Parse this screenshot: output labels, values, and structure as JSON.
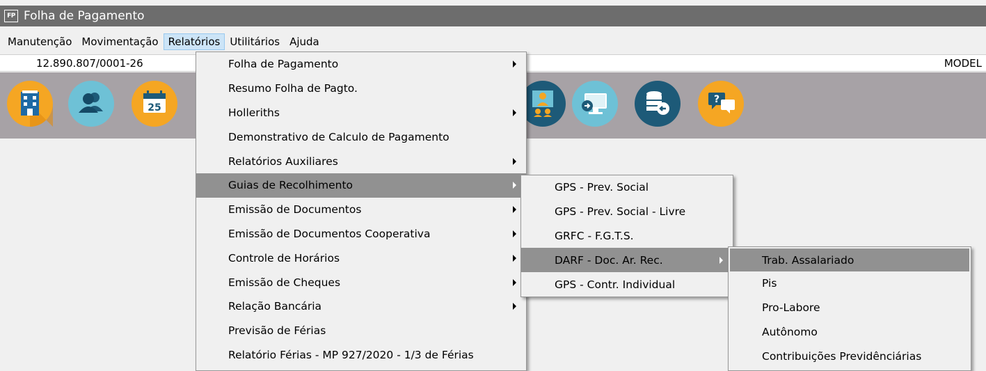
{
  "window": {
    "title": "Folha de Pagamento",
    "icon_text": "FP"
  },
  "menubar": {
    "items": [
      {
        "label": "Manutenção"
      },
      {
        "label": "Movimentação"
      },
      {
        "label": "Relatórios"
      },
      {
        "label": "Utilitários"
      },
      {
        "label": "Ajuda"
      }
    ],
    "active": "Relatórios"
  },
  "infobar": {
    "cnpj": "12.890.807/0001-26",
    "company": "MODEL"
  },
  "toolbar": {
    "buttons": [
      {
        "icon": "building-icon",
        "color": "#f5a623"
      },
      {
        "icon": "users-icon",
        "color": "#6ec1d6"
      },
      {
        "icon": "calendar-icon",
        "color": "#f5a623"
      },
      {
        "icon": "employee-icon",
        "color": "#1d5a78"
      },
      {
        "icon": "monitor-icon",
        "color": "#6ec1d6"
      },
      {
        "icon": "database-icon",
        "color": "#1d5a78"
      },
      {
        "icon": "help-chat-icon",
        "color": "#f5a623"
      }
    ]
  },
  "relatorios_menu": {
    "items": [
      {
        "label": "Folha de Pagamento",
        "submenu": true
      },
      {
        "label": "Resumo Folha de Pagto.",
        "submenu": false
      },
      {
        "label": "Holleriths",
        "submenu": true
      },
      {
        "label": "Demonstrativo de Calculo de Pagamento",
        "submenu": false
      },
      {
        "label": "Relatórios Auxiliares",
        "submenu": true
      },
      {
        "label": "Guias de Recolhimento",
        "submenu": true,
        "highlighted": true
      },
      {
        "label": "Emissão de Documentos",
        "submenu": true
      },
      {
        "label": "Emissão de Documentos Cooperativa",
        "submenu": true
      },
      {
        "label": "Controle de Horários",
        "submenu": true
      },
      {
        "label": "Emissão de Cheques",
        "submenu": true
      },
      {
        "label": "Relação Bancária",
        "submenu": true
      },
      {
        "label": "Previsão de Férias",
        "submenu": false
      },
      {
        "label": "Relatório Férias - MP 927/2020 - 1/3 de Férias",
        "submenu": false
      }
    ]
  },
  "guias_menu": {
    "items": [
      {
        "label": "GPS - Prev. Social",
        "submenu": false
      },
      {
        "label": "GPS - Prev. Social - Livre",
        "submenu": false
      },
      {
        "label": "GRFC - F.G.T.S.",
        "submenu": false
      },
      {
        "label": "DARF - Doc. Ar. Rec.",
        "submenu": true,
        "highlighted": true
      },
      {
        "label": "GPS - Contr. Individual",
        "submenu": false
      }
    ]
  },
  "darf_menu": {
    "items": [
      {
        "label": "Trab. Assalariado",
        "highlighted": true
      },
      {
        "label": "Pis"
      },
      {
        "label": "Pro-Labore"
      },
      {
        "label": "Autônomo"
      },
      {
        "label": "Contribuições Previdênciárias"
      }
    ]
  }
}
